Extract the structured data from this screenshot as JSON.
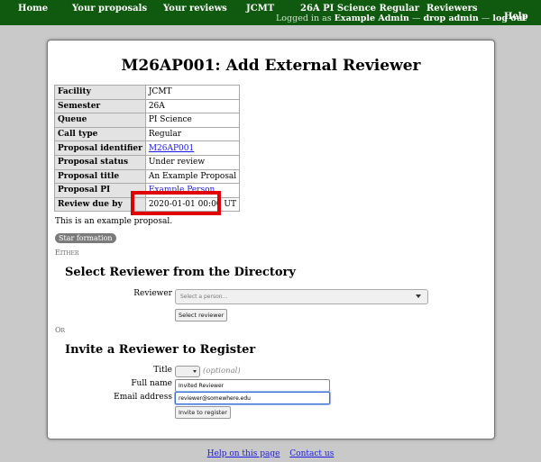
{
  "nav": {
    "home": "Home",
    "your_proposals": "Your proposals",
    "your_reviews": "Your reviews",
    "jcmt": "JCMT",
    "call": "26A PI Science Regular",
    "reviewers": "Reviewers",
    "help": "Help",
    "logged_in_as": "Logged in as",
    "user": "Example Admin",
    "sep1": "—",
    "drop_admin": "drop admin",
    "sep2": "—",
    "log_out": "log out"
  },
  "page": {
    "title": "M26AP001: Add External Reviewer"
  },
  "info_table": [
    {
      "label": "Facility",
      "value": "JCMT",
      "link": false
    },
    {
      "label": "Semester",
      "value": "26A",
      "link": false
    },
    {
      "label": "Queue",
      "value": "PI Science",
      "link": false
    },
    {
      "label": "Call type",
      "value": "Regular",
      "link": false
    },
    {
      "label": "Proposal identifier",
      "value": "M26AP001",
      "link": true
    },
    {
      "label": "Proposal status",
      "value": "Under review",
      "link": false
    },
    {
      "label": "Proposal title",
      "value": "An Example Proposal",
      "link": false
    },
    {
      "label": "Proposal PI",
      "value": "Example Person",
      "link": true
    },
    {
      "label": "Review due by",
      "value": "2020-01-01 00:00 UT",
      "link": false
    }
  ],
  "abstract": "This is an example proposal.",
  "category": "Star formation",
  "either": "Either",
  "or": "Or",
  "directory": {
    "heading": "Select Reviewer from the Directory",
    "reviewer_label": "Reviewer",
    "select_placeholder": "Select a person...",
    "button": "Select reviewer"
  },
  "invite": {
    "heading": "Invite a Reviewer to Register",
    "title_label": "Title",
    "optional": "(optional)",
    "full_name_label": "Full name",
    "full_name_value": "Invited Reviewer",
    "email_label": "Email address",
    "email_value": "reviewer@somewhere.edu",
    "button": "Invite to register"
  },
  "footer": {
    "help": "Help on this page",
    "contact": "Contact us"
  },
  "colors": {
    "nav_bg": "#0f5a0f",
    "highlight": "#e00000",
    "link": "#1a1ae6"
  }
}
